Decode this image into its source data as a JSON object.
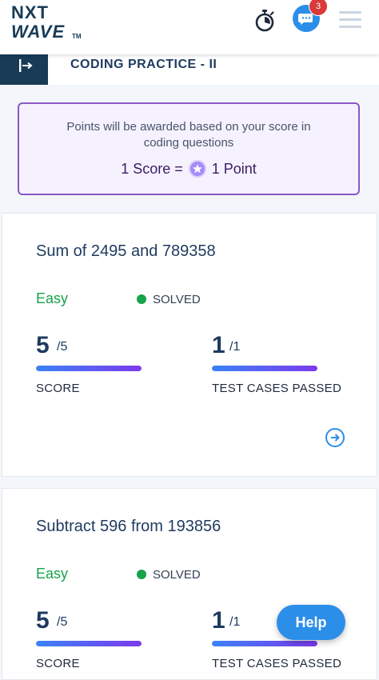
{
  "app": {
    "logo_line1": "NXT",
    "logo_line2": "WAVE",
    "logo_tm": "TM",
    "notification_count": "3"
  },
  "header": {
    "title": "CODING PRACTICE - II"
  },
  "notice": {
    "line1": "Points will be awarded based on your score in",
    "line2": "coding questions",
    "score_text": "1 Score =",
    "point_text": "1 Point"
  },
  "questions": [
    {
      "title": "Sum of 2495 and 789358",
      "difficulty": "Easy",
      "status": "SOLVED",
      "score": "5",
      "score_total": "/5",
      "score_fraction": 1.0,
      "score_label": "SCORE",
      "tests": "1",
      "tests_total": "/1",
      "tests_fraction": 1.0,
      "tests_label": "TEST CASES PASSED"
    },
    {
      "title": "Subtract 596 from 193856",
      "difficulty": "Easy",
      "status": "SOLVED",
      "score": "5",
      "score_total": "/5",
      "score_fraction": 1.0,
      "score_label": "SCORE",
      "tests": "1",
      "tests_total": "/1",
      "tests_fraction": 1.0,
      "tests_label": "TEST CASES PASSED"
    }
  ],
  "help": {
    "label": "Help"
  },
  "colors": {
    "brand": "#183b56",
    "accent": "#2b8ee8",
    "easy": "#16a34a",
    "notice_border": "#8b57c6"
  },
  "icons": {
    "back": "exit-arrow-icon",
    "timer": "stopwatch-icon",
    "chat": "chat-bubble-icon",
    "menu": "hamburger-menu-icon",
    "star": "star-coin-icon",
    "open": "arrow-right-circle-icon"
  }
}
